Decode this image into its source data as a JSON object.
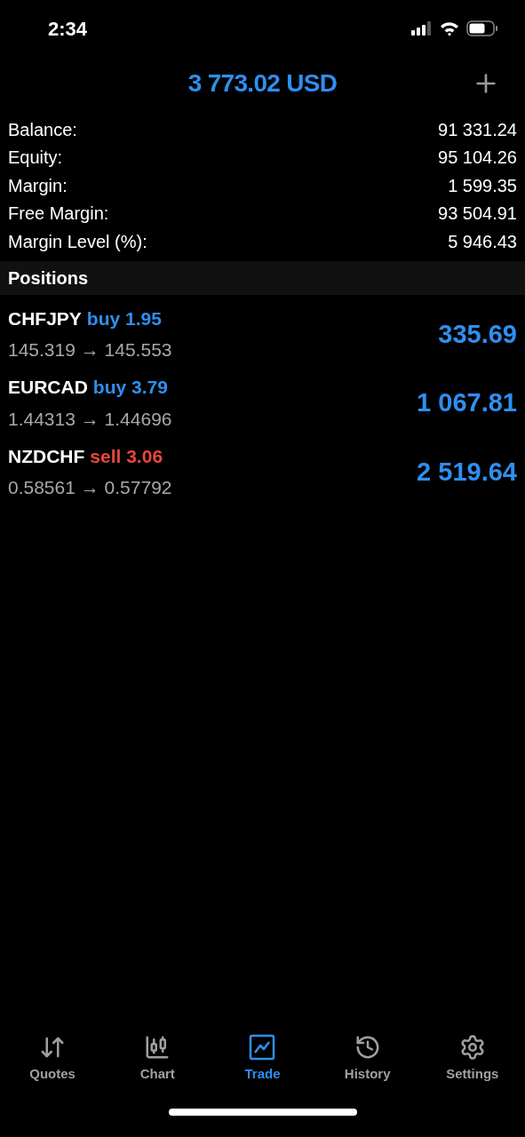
{
  "status_bar": {
    "time": "2:34"
  },
  "header": {
    "title": "3 773.02 USD"
  },
  "summary": [
    {
      "label": "Balance:",
      "value": "91 331.24"
    },
    {
      "label": "Equity:",
      "value": "95 104.26"
    },
    {
      "label": "Margin:",
      "value": "1 599.35"
    },
    {
      "label": "Free Margin:",
      "value": "93 504.91"
    },
    {
      "label": "Margin Level (%):",
      "value": "5 946.43"
    }
  ],
  "positions_header": "Positions",
  "positions": [
    {
      "symbol": "CHFJPY",
      "kind": "buy",
      "order": "buy 1.95",
      "prices": "145.319 → 145.553",
      "profit": "335.69"
    },
    {
      "symbol": "EURCAD",
      "kind": "buy",
      "order": "buy 3.79",
      "prices": "1.44313 → 1.44696",
      "profit": "1 067.81"
    },
    {
      "symbol": "NZDCHF",
      "kind": "sell",
      "order": "sell 3.06",
      "prices": "0.58561 → 0.57792",
      "profit": "2 519.64"
    }
  ],
  "tabs": [
    {
      "label": "Quotes",
      "kind": "quotes",
      "selected": false
    },
    {
      "label": "Chart",
      "kind": "chart",
      "selected": false
    },
    {
      "label": "Trade",
      "kind": "trade",
      "selected": true
    },
    {
      "label": "History",
      "kind": "history",
      "selected": false
    },
    {
      "label": "Settings",
      "kind": "settings",
      "selected": false
    }
  ]
}
